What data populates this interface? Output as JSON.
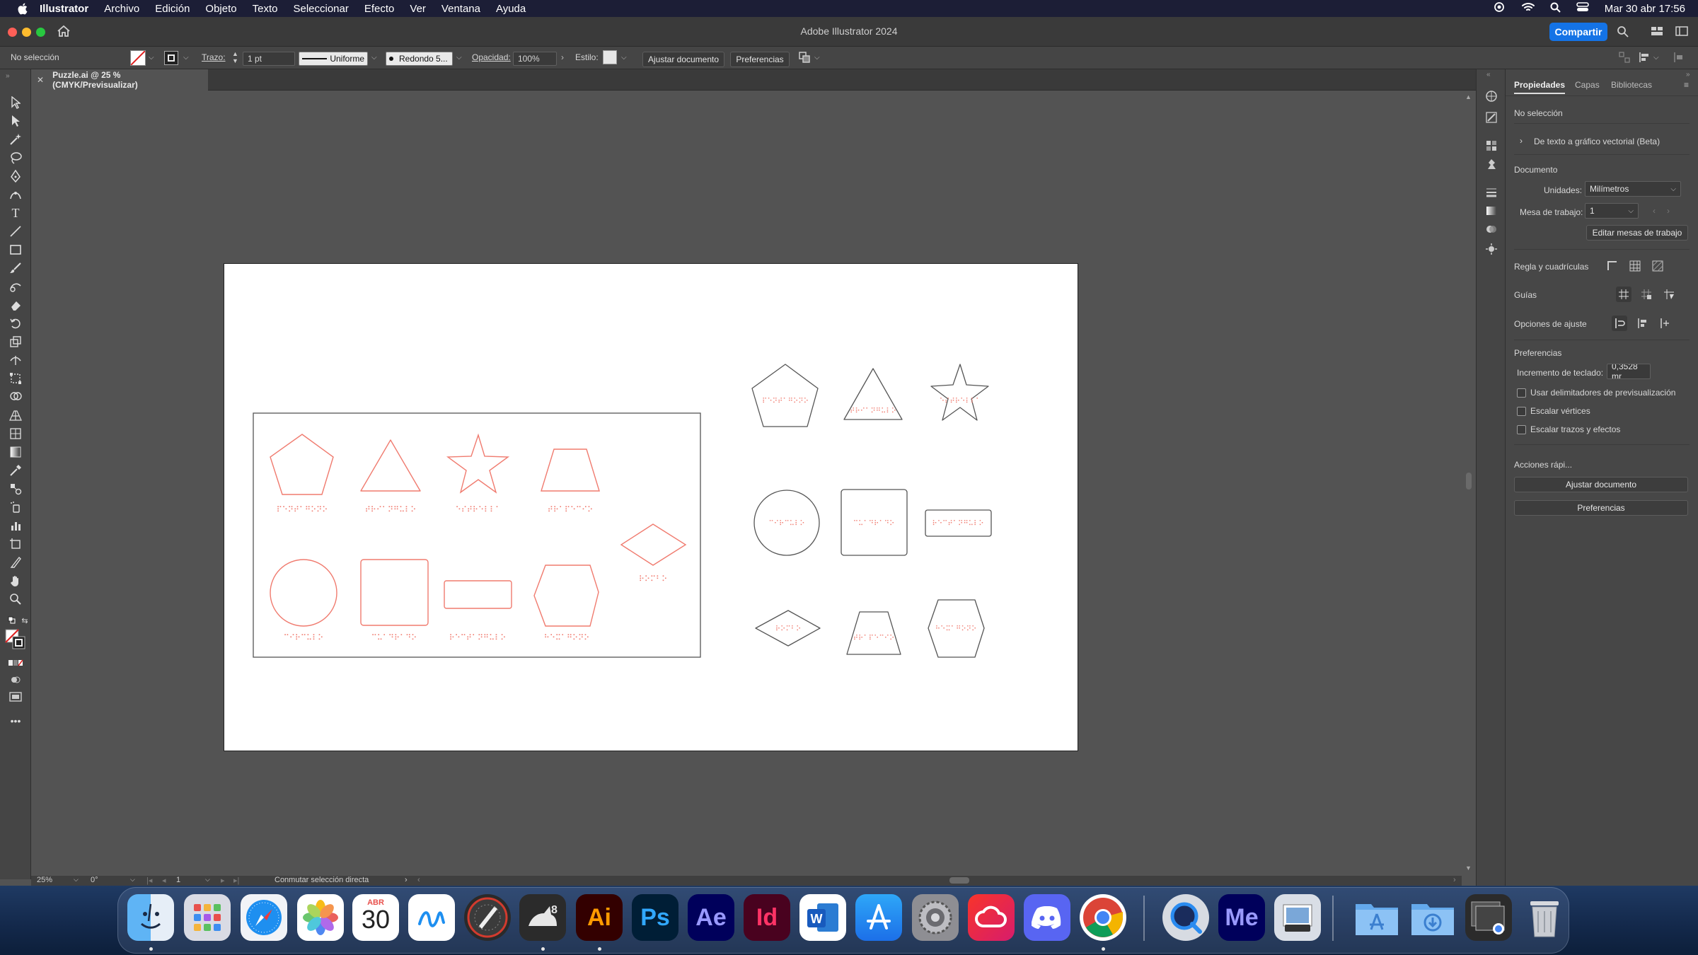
{
  "menubar": {
    "app_name": "Illustrator",
    "items": [
      "Archivo",
      "Edición",
      "Objeto",
      "Texto",
      "Seleccionar",
      "Efecto",
      "Ver",
      "Ventana",
      "Ayuda"
    ],
    "clock": "Mar 30 abr  17:56"
  },
  "titlebar": {
    "title": "Adobe Illustrator 2024",
    "share_label": "Compartir"
  },
  "controlbar": {
    "selection": "No selección",
    "stroke_label": "Trazo:",
    "stroke_weight": "1 pt",
    "profile": "Uniforme",
    "brush": "Redondo 5...",
    "opacity_label": "Opacidad:",
    "opacity_value": "100%",
    "style_label": "Estilo:",
    "fit_document": "Ajustar documento",
    "preferences": "Preferencias"
  },
  "document": {
    "tab_title": "Puzzle.ai @ 25 % (CMYK/Previsualizar)"
  },
  "artboard": {
    "braille_labels": {
      "pentagon": "⠏⠑⠝⠞⠁⠛⠕⠝⠕",
      "triangle": "⠞⠗⠊⠁⠝⠛⠥⠇⠕",
      "star": "⠑⠎⠞⠗⠑⠇⠇⠁",
      "trapezoid": "⠞⠗⠁⠏⠑⠉⠊⠕",
      "rhombus": "⠗⠕⠍⠃⠕",
      "circle": "⠉⠊⠗⠉⠥⠇⠕",
      "square": "⠉⠥⠁⠙⠗⠁⠙⠕",
      "rectangle": "⠗⠑⠉⠞⠁⠝⠛⠥⠇⠕",
      "hexagon": "⠓⠑⠭⠁⠛⠕⠝⠕"
    },
    "colors": {
      "cut_red": "#f07b6f",
      "outline_dark": "#555555"
    }
  },
  "statusbar": {
    "zoom": "25%",
    "rotation": "0°",
    "artboard_num": "1",
    "tool_hint": "Conmutar selección directa"
  },
  "panel": {
    "tabs": [
      "Propiedades",
      "Capas",
      "Bibliotecas"
    ],
    "selection": "No selección",
    "text_to_vector": "De texto a gráfico vectorial (Beta)",
    "document_heading": "Documento",
    "units_label": "Unidades:",
    "units_value": "Milímetros",
    "artboard_label": "Mesa de trabajo:",
    "artboard_value": "1",
    "edit_artboards": "Editar mesas de trabajo",
    "rulers_grids": "Regla y cuadrículas",
    "guides": "Guías",
    "snap_options": "Opciones de ajuste",
    "preferences_heading": "Preferencias",
    "keyboard_increment_label": "Incremento de teclado:",
    "keyboard_increment_value": "0,3528 mr",
    "checkboxes": [
      "Usar delimitadores de previsualización",
      "Escalar vértices",
      "Escalar trazos y efectos"
    ],
    "quick_actions": "Acciones rápi...",
    "btn_fit_document": "Ajustar documento",
    "btn_preferences": "Preferencias"
  },
  "dock": {
    "calendar_month": "ABR",
    "calendar_day": "30",
    "apps": [
      "Finder",
      "Launchpad",
      "Safari",
      "Fotos",
      "Calendario",
      "Freeform",
      "Pro Tools",
      "Rhino 8",
      "Illustrator",
      "Photoshop",
      "After Effects",
      "InDesign",
      "Word",
      "App Store",
      "Configuración",
      "Creative Cloud",
      "Discord",
      "Chrome",
      "QuickTime",
      "Media Encoder",
      "Vista previa",
      "Aplicaciones",
      "Descargas",
      "Capturas",
      "Papelera"
    ],
    "labels": {
      "ai": "Ai",
      "ps": "Ps",
      "ae": "Ae",
      "id": "Id",
      "me": "Me"
    }
  }
}
